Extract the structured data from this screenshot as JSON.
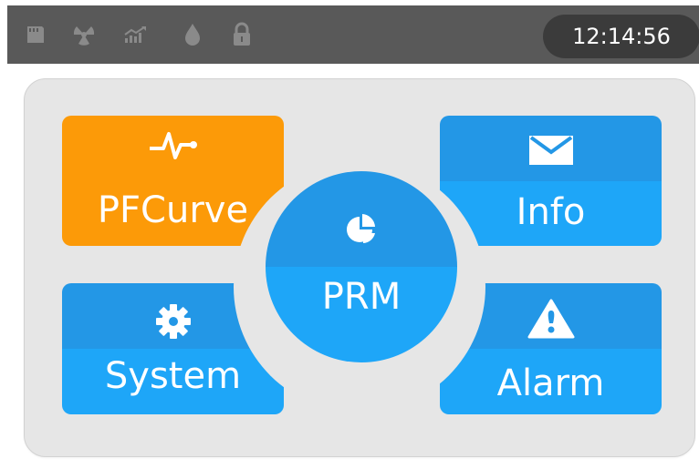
{
  "status_bar": {
    "icons": [
      "sd-card-icon",
      "radiation-icon",
      "trend-chart-icon",
      "water-drop-icon",
      "lock-icon"
    ],
    "time": "12:14:56",
    "colors": {
      "bar": "#595959",
      "icon": "#8a8a8a",
      "clock_bg": "#3b3b3b"
    }
  },
  "menu": {
    "pfcurve": {
      "label": "PFCurve",
      "icon": "heartbeat-pulse-icon",
      "color": "#fc9a08"
    },
    "info": {
      "label": "Info",
      "icon": "envelope-icon",
      "color": "#1ea6f8"
    },
    "system": {
      "label": "System",
      "icon": "gear-icon",
      "color": "#1ea6f8"
    },
    "alarm": {
      "label": "Alarm",
      "icon": "warning-triangle-icon",
      "color": "#1ea6f8"
    },
    "prm": {
      "label": "PRM",
      "icon": "pie-chart-icon",
      "color": "#1ea6f8"
    }
  }
}
